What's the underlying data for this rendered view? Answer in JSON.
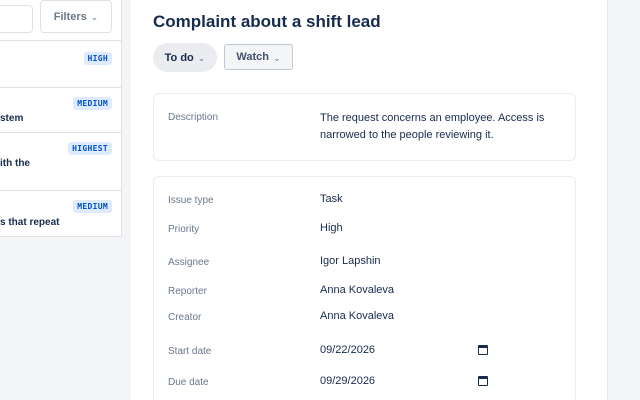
{
  "list_panel": {
    "filters_label": "Filters",
    "issues": [
      {
        "priority": "HIGH",
        "text": ""
      },
      {
        "priority": "MEDIUM",
        "text": "stem"
      },
      {
        "priority": "HIGHEST",
        "text": "ith the"
      },
      {
        "priority": "MEDIUM",
        "text": "s that repeat"
      }
    ]
  },
  "issue": {
    "title": "Complaint about a shift lead",
    "status_label": "To do",
    "watch_label": "Watch",
    "description_label": "Description",
    "description": "The request concerns an employee. Access is narrowed to the people reviewing it.",
    "fields": {
      "issue_type": {
        "label": "Issue type",
        "value": "Task"
      },
      "priority": {
        "label": "Priority",
        "value": "High"
      },
      "assignee": {
        "label": "Assignee",
        "value": "Igor Lapshin"
      },
      "reporter": {
        "label": "Reporter",
        "value": "Anna Kovaleva"
      },
      "creator": {
        "label": "Creator",
        "value": "Anna Kovaleva"
      },
      "start_date": {
        "label": "Start date",
        "value": "09/22/2026"
      },
      "due_date": {
        "label": "Due date",
        "value": "09/29/2026"
      }
    }
  },
  "icons": {
    "chevron": "chevron-down-icon",
    "calendar": "calendar-icon"
  }
}
